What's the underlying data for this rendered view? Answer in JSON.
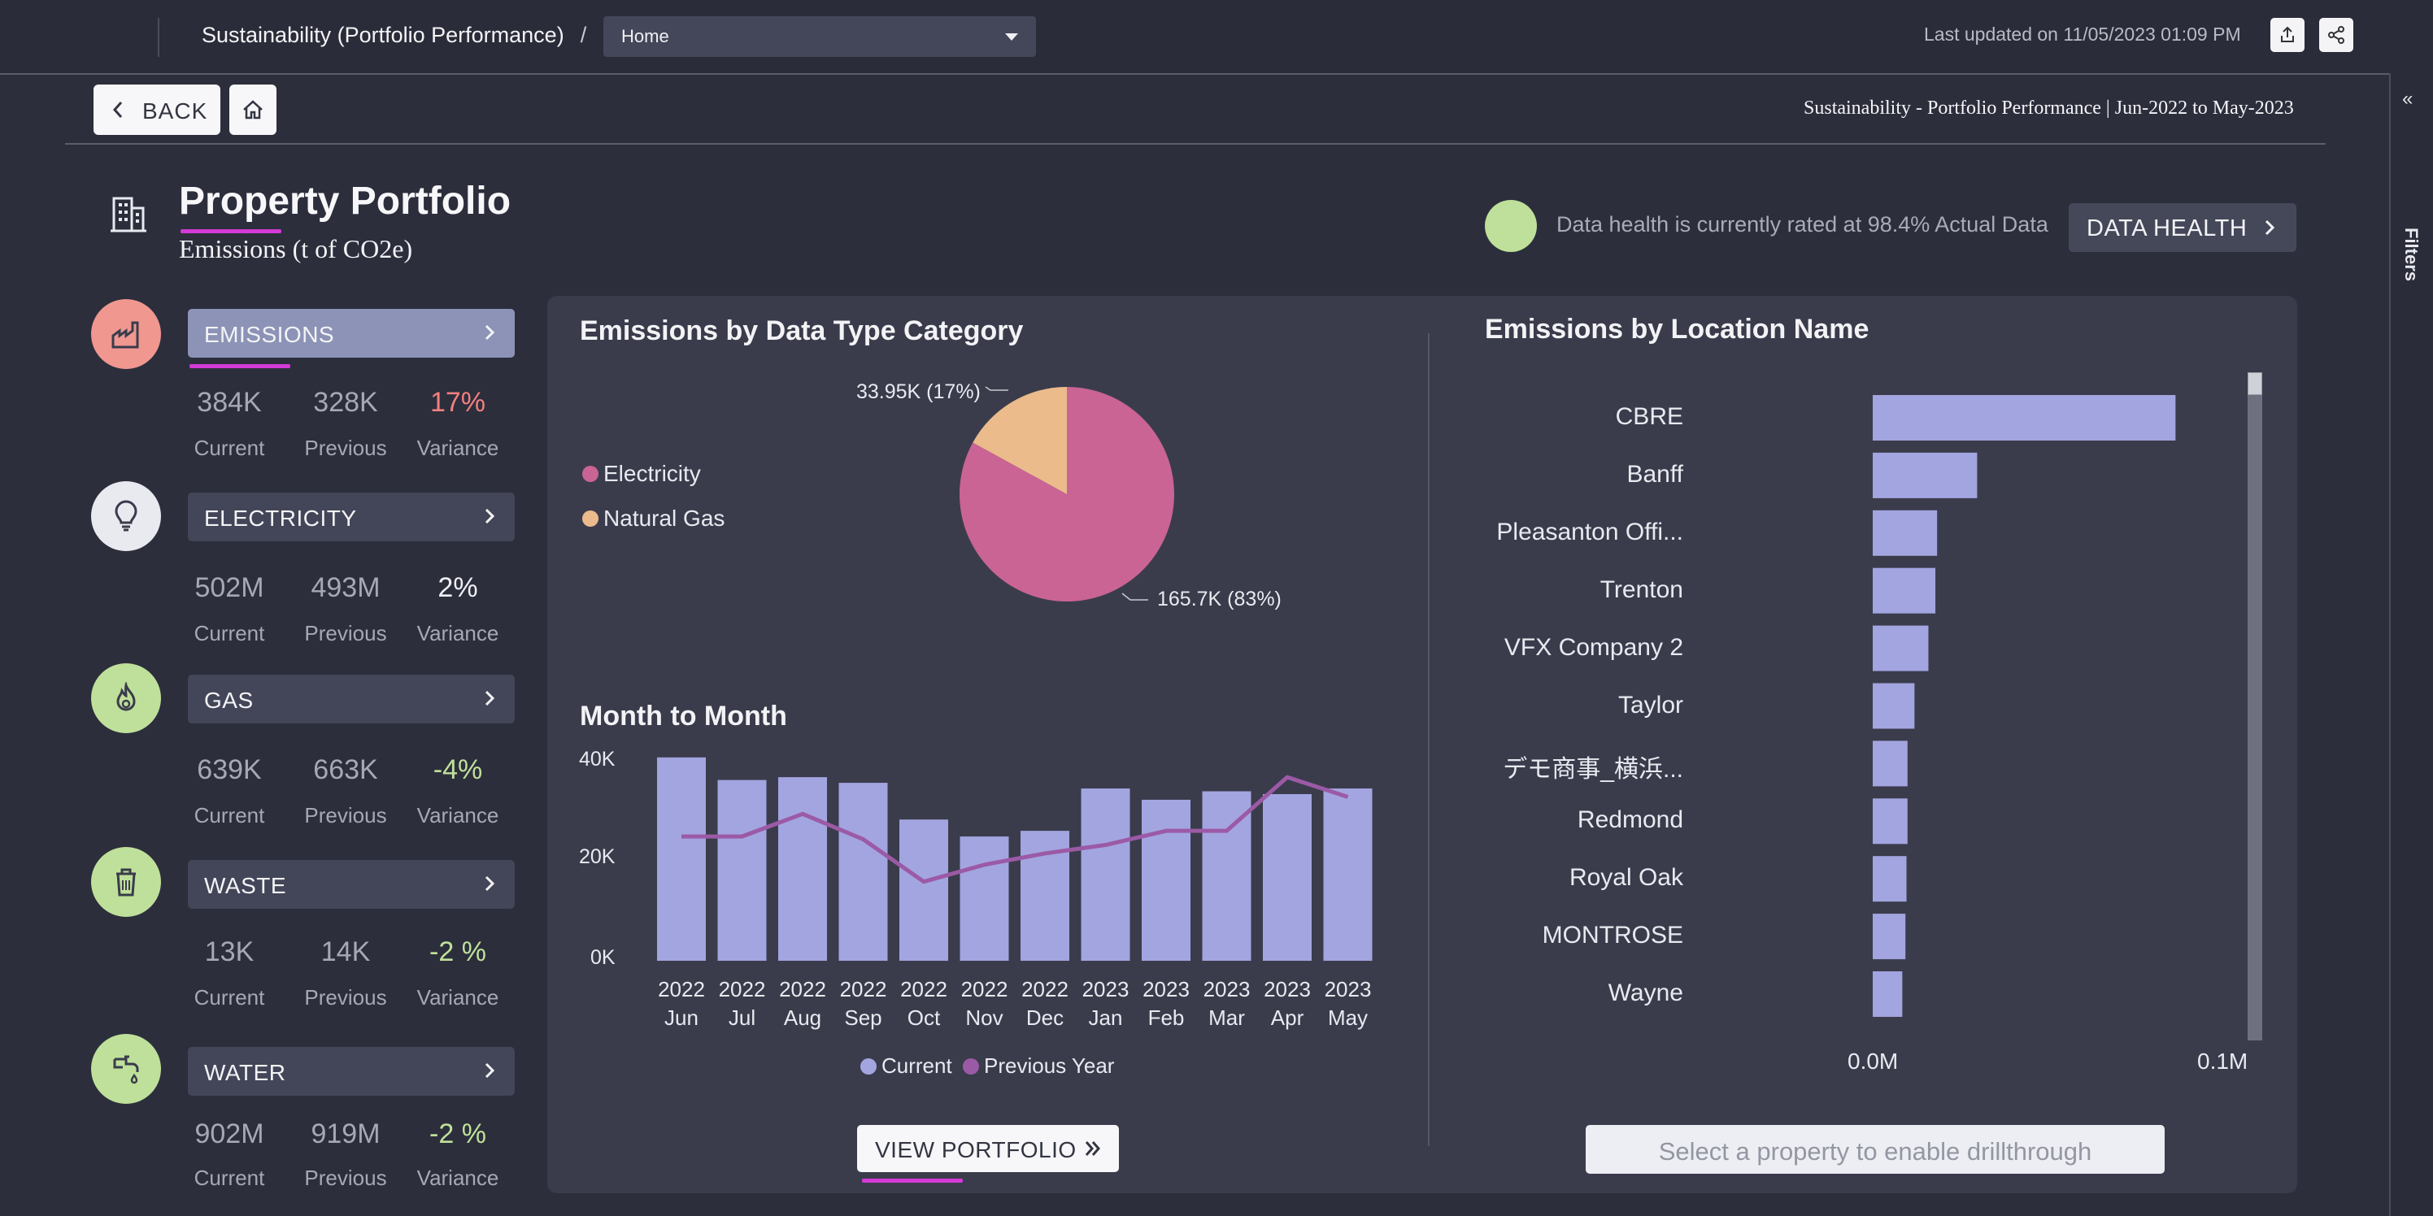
{
  "topbar": {
    "breadcrumb": "Sustainability (Portfolio Performance)",
    "separator": "/",
    "page_select": "Home",
    "last_updated": "Last updated on 11/05/2023 01:09 PM"
  },
  "filters_label": "Filters",
  "nav": {
    "back_label": "BACK"
  },
  "report_subtitle": "Sustainability - Portfolio Performance | Jun-2022 to May-2023",
  "header": {
    "title": "Property Portfolio",
    "subtitle": "Emissions (t of CO2e)",
    "health_text": "Data health is currently rated at 98.4% Actual Data",
    "health_button": "DATA HEALTH"
  },
  "colors": {
    "accent_magenta": "#d43ad8",
    "bar": "#a3a5e0",
    "line": "#9b5aa6",
    "pie_electricity": "#c96494",
    "pie_gas": "#ecbb8c",
    "health_green": "#bfe09a",
    "variance_red": "#f27f7f"
  },
  "categories": [
    {
      "label": "EMISSIONS",
      "icon": "factory-icon",
      "current": "384K",
      "previous": "328K",
      "variance": "17%",
      "current_lbl": "Current",
      "previous_lbl": "Previous",
      "variance_lbl": "Variance"
    },
    {
      "label": "ELECTRICITY",
      "icon": "lightbulb-icon",
      "current": "502M",
      "previous": "493M",
      "variance": "2%",
      "current_lbl": "Current",
      "previous_lbl": "Previous",
      "variance_lbl": "Variance"
    },
    {
      "label": "GAS",
      "icon": "flame-icon",
      "current": "639K",
      "previous": "663K",
      "variance": "-4%",
      "current_lbl": "Current",
      "previous_lbl": "Previous",
      "variance_lbl": "Variance"
    },
    {
      "label": "WASTE",
      "icon": "recycle-bin-icon",
      "current": "13K",
      "previous": "14K",
      "variance": "-2 %",
      "current_lbl": "Current",
      "previous_lbl": "Previous",
      "variance_lbl": "Variance"
    },
    {
      "label": "WATER",
      "icon": "water-tap-icon",
      "current": "902M",
      "previous": "919M",
      "variance": "-2 %",
      "current_lbl": "Current",
      "previous_lbl": "Previous",
      "variance_lbl": "Variance"
    }
  ],
  "buttons": {
    "view_portfolio": "VIEW PORTFOLIO",
    "drillthrough": "Select a property to enable drillthrough"
  },
  "chart_data": [
    {
      "type": "pie",
      "title": "Emissions by Data Type Category",
      "slices": [
        {
          "name": "Electricity",
          "value": 165.7,
          "label": "165.7K (83%)"
        },
        {
          "name": "Natural Gas",
          "value": 33.95,
          "label": "33.95K (17%)"
        }
      ],
      "legend": [
        "Electricity",
        "Natural Gas"
      ],
      "legend_position": "left"
    },
    {
      "type": "bar",
      "title": "Month to Month",
      "categories": [
        [
          "2022",
          "Jun"
        ],
        [
          "2022",
          "Jul"
        ],
        [
          "2022",
          "Aug"
        ],
        [
          "2022",
          "Sep"
        ],
        [
          "2022",
          "Oct"
        ],
        [
          "2022",
          "Nov"
        ],
        [
          "2022",
          "Dec"
        ],
        [
          "2023",
          "Jan"
        ],
        [
          "2023",
          "Feb"
        ],
        [
          "2023",
          "Mar"
        ],
        [
          "2023",
          "Apr"
        ],
        [
          "2023",
          "May"
        ]
      ],
      "y_ticks": [
        "40K",
        "20K",
        "0K"
      ],
      "ylim": [
        0,
        40000
      ],
      "series": [
        {
          "name": "Current",
          "kind": "bar",
          "values": [
            36000,
            32000,
            32500,
            31500,
            25000,
            22000,
            23000,
            30500,
            28500,
            30000,
            29500,
            30500
          ]
        },
        {
          "name": "Previous Year",
          "kind": "line",
          "values": [
            22000,
            22000,
            26000,
            21500,
            14000,
            17000,
            19000,
            20500,
            23000,
            23000,
            32500,
            29000
          ]
        }
      ],
      "legend_position": "bottom"
    },
    {
      "type": "bar",
      "orientation": "horizontal",
      "title": "Emissions by Location Name",
      "categories": [
        "CBRE",
        "Banff",
        "Pleasanton Offi...",
        "Trenton",
        "VFX Company 2",
        "Taylor",
        "デモ商事_横浜...",
        "Redmond",
        "Royal Oak",
        "MONTROSE",
        "Wayne"
      ],
      "values": [
        0.087,
        0.03,
        0.0185,
        0.018,
        0.016,
        0.012,
        0.01,
        0.01,
        0.0097,
        0.0094,
        0.0085
      ],
      "x_ticks": [
        "0.0M",
        "0.1M"
      ],
      "xlim": [
        0,
        0.1
      ]
    }
  ]
}
